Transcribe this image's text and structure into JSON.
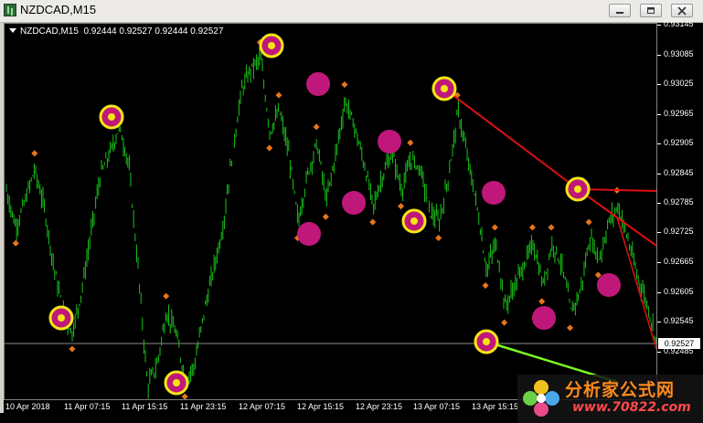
{
  "window": {
    "title": "NZDCAD,M15",
    "buttons": {
      "minimize": "minimize-icon",
      "maximize": "maximize-icon",
      "close": "close-icon"
    }
  },
  "chart_info": {
    "symbol": "NZDCAD,M15",
    "ohlc": "0.92444 0.92527 0.92444 0.92527"
  },
  "y_axis": {
    "labels": [
      "0.93145",
      "0.93085",
      "0.93025",
      "0.92965",
      "0.92905",
      "0.92845",
      "0.92785",
      "0.92725",
      "0.92665",
      "0.92605",
      "0.92545",
      "0.92485"
    ],
    "current_price": "0.92527"
  },
  "x_axis": {
    "labels": [
      "10 Apr 2018",
      "11 Apr 07:15",
      "11 Apr 15:15",
      "11 Apr 23:15",
      "12 Apr 07:15",
      "12 Apr 15:15",
      "12 Apr 23:15",
      "13 Apr 07:15",
      "13 Apr 15:15"
    ]
  },
  "watermark": {
    "title": "分析家公式网",
    "url": "www.70822.com"
  },
  "colors": {
    "background": "#000000",
    "bars": "#19c419",
    "fractal": "#e8751a",
    "highlight_yellow": "#f5e614",
    "highlight_magenta": "#c0187a",
    "trendline_red": "#e01010",
    "trendline_green": "#7cfc20",
    "grid_hline": "#8a8a8a"
  },
  "chart_data": {
    "type": "bar",
    "symbol": "NZDCAD",
    "timeframe": "M15",
    "y_range": [
      0.92455,
      0.93165
    ],
    "current_price": 0.92527,
    "series": [
      {
        "values": [
          0.9285,
          0.9278,
          0.9283,
          0.9289,
          0.9282,
          0.9271,
          0.9262,
          0.9258,
          0.9266,
          0.9277,
          0.9288,
          0.9292,
          0.9297,
          0.929,
          0.927,
          0.9248,
          0.9252,
          0.9262,
          0.9258,
          0.9249,
          0.9252,
          0.9262,
          0.927,
          0.9278,
          0.9292,
          0.9304,
          0.9308,
          0.931,
          0.9296,
          0.93,
          0.9292,
          0.9279,
          0.9288,
          0.9294,
          0.9283,
          0.9292,
          0.9302,
          0.9297,
          0.929,
          0.9282,
          0.9288,
          0.9292,
          0.9285,
          0.9291,
          0.9289,
          0.9281,
          0.9279,
          0.9288,
          0.93,
          0.9291,
          0.9282,
          0.927,
          0.9275,
          0.9263,
          0.9267,
          0.9271,
          0.9275,
          0.9267,
          0.9275,
          0.9271,
          0.9262,
          0.9266,
          0.9276,
          0.9272,
          0.9279,
          0.9282,
          0.9276,
          0.9269,
          0.9264,
          0.9257
        ]
      }
    ]
  }
}
